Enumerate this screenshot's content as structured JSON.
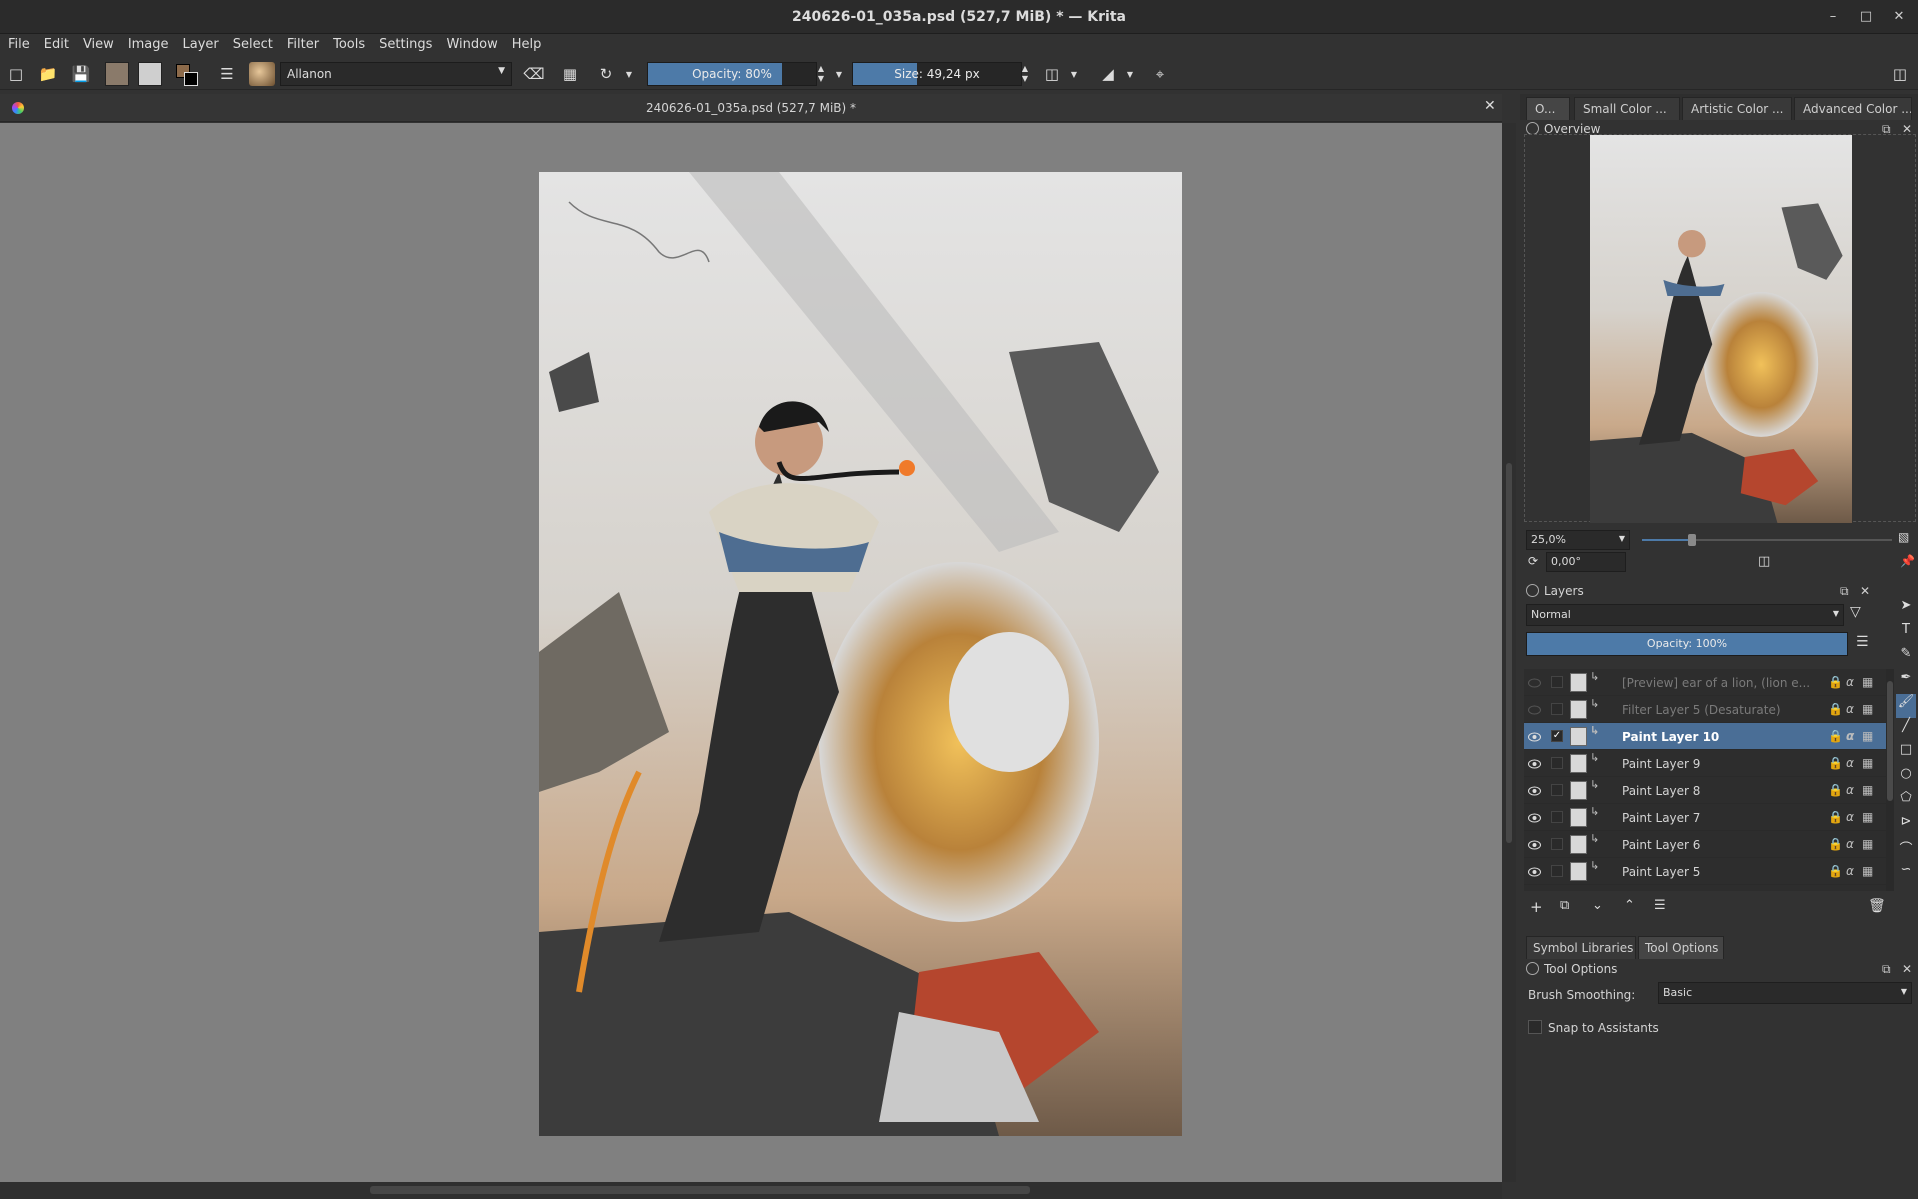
{
  "window": {
    "title": "240626-01_035a.psd (527,7 MiB) * — Krita"
  },
  "menu": [
    "File",
    "Edit",
    "View",
    "Image",
    "Layer",
    "Select",
    "Filter",
    "Tools",
    "Settings",
    "Window",
    "Help"
  ],
  "toolbar": {
    "brush_preset": "Allanon",
    "opacity_label": "Opacity: 80%",
    "opacity_value": 80,
    "size_label": "Size: 49,24 px"
  },
  "document": {
    "tab_title": "240626-01_035a.psd (527,7 MiB) *"
  },
  "dock_tabs": [
    "O...",
    "Small Color ...",
    "Artistic Color ...",
    "Advanced Color ..."
  ],
  "overview": {
    "title": "Overview",
    "zoom": "25,0%",
    "rotation": "0,00°"
  },
  "layers": {
    "title": "Layers",
    "blend_mode": "Normal",
    "opacity_label": "Opacity:  100%",
    "items": [
      {
        "name": "[Preview] ear of a lion, (lion e...",
        "visible": false,
        "selected": false
      },
      {
        "name": "Filter Layer 5 (Desaturate)",
        "visible": false,
        "selected": false
      },
      {
        "name": "Paint Layer 10",
        "visible": true,
        "selected": true
      },
      {
        "name": "Paint Layer 9",
        "visible": true,
        "selected": false
      },
      {
        "name": "Paint Layer 8",
        "visible": true,
        "selected": false
      },
      {
        "name": "Paint Layer 7",
        "visible": true,
        "selected": false
      },
      {
        "name": "Paint Layer 6",
        "visible": true,
        "selected": false
      },
      {
        "name": "Paint Layer 5",
        "visible": true,
        "selected": false
      }
    ]
  },
  "bottom_tabs": [
    "Symbol Libraries",
    "Tool Options"
  ],
  "tool_options": {
    "title": "Tool Options",
    "brush_smoothing_label": "Brush Smoothing:",
    "brush_smoothing_value": "Basic",
    "snap_label": "Snap to Assistants"
  }
}
